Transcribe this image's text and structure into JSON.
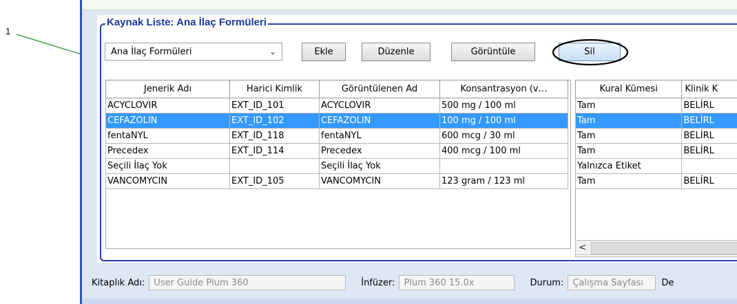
{
  "callout": {
    "number": "1"
  },
  "group": {
    "title": "Kaynak Liste: Ana İlaç Formüleri"
  },
  "formulary_select": {
    "value": "Ana İlaç Formüleri"
  },
  "buttons": {
    "add": "Ekle",
    "edit": "Düzenle",
    "view": "Görüntüle",
    "delete": "Sil"
  },
  "left_table": {
    "columns": [
      "Jenerik Adı",
      "Harici Kimlik",
      "Görüntülenen Ad",
      "Konsantrasyon (v…"
    ],
    "rows": [
      [
        "ACYCLOVIR",
        "EXT_ID_101",
        "ACYCLOVIR",
        "500 mg / 100 ml"
      ],
      [
        "CEFAZOLIN",
        "EXT_ID_102",
        "CEFAZOLIN",
        "100 mg / 100 ml"
      ],
      [
        "fentaNYL",
        "EXT_ID_118",
        "fentaNYL",
        "600 mcg / 30 ml"
      ],
      [
        "Precedex",
        "EXT_ID_114",
        "Precedex",
        "400 mcg / 100 ml"
      ],
      [
        "Seçili İlaç Yok",
        "",
        "Seçili İlaç Yok",
        ""
      ],
      [
        "VANCOMYCIN",
        "EXT_ID_105",
        "VANCOMYCIN",
        "123 gram / 123 ml"
      ]
    ],
    "selected_row": 1
  },
  "right_table": {
    "columns": [
      "Kural Kümesi",
      "Klinik K"
    ],
    "rows": [
      [
        "Tam",
        "BELİRL"
      ],
      [
        "Tam",
        "BELİRL"
      ],
      [
        "Tam",
        "BELİRL"
      ],
      [
        "Tam",
        "BELİRL"
      ],
      [
        "Yalnızca Etiket",
        ""
      ],
      [
        "Tam",
        "BELİRL"
      ]
    ],
    "selected_row": 1
  },
  "scrollbar": {
    "left_arrow": "<"
  },
  "footer": {
    "library_label": "Kitaplık Adı:",
    "library_value": "User Guide Plum 360",
    "infuser_label": "İnfüzer:",
    "infuser_value": "Plum 360 15.0x",
    "status_label": "Durum:",
    "status_value": "Çalışma Sayfası",
    "cutoff_label": "De"
  },
  "colors": {
    "accent": "#1f3fb0",
    "selection": "#3399ff",
    "callout": "#2e8b2e"
  }
}
